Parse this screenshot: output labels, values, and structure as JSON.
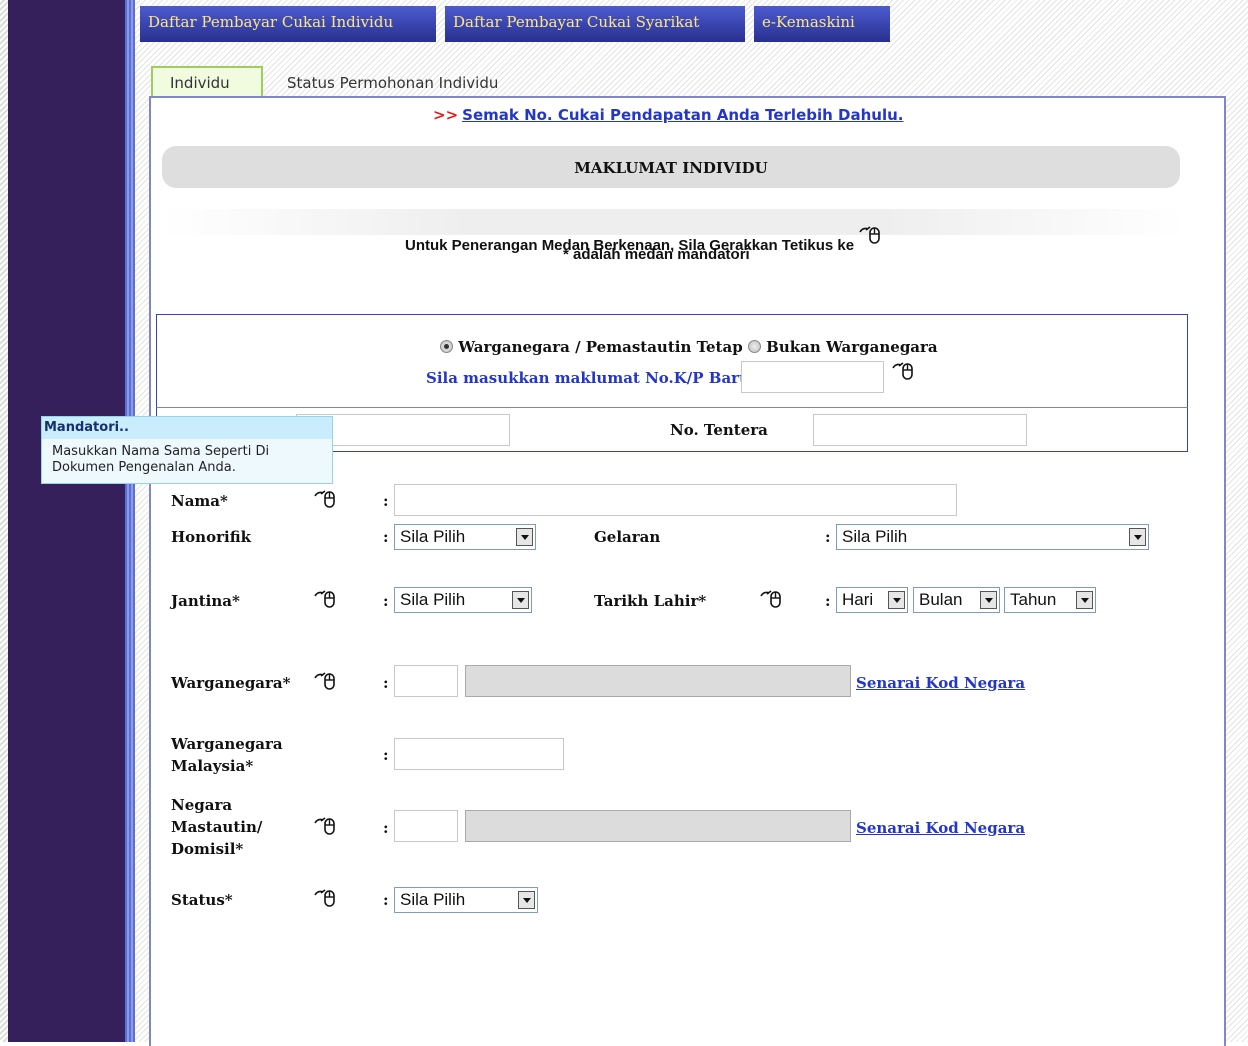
{
  "nav": {
    "tabs": [
      "Daftar Pembayar Cukai Individu",
      "Daftar Pembayar Cukai Syarikat",
      "e-Kemaskini"
    ]
  },
  "subtabs": {
    "active": "Individu",
    "other": "Status Permohonan Individu"
  },
  "check_link": {
    "arrow": ">>",
    "text": "Semak No. Cukai Pendapatan Anda Terlebih Dahulu."
  },
  "section": {
    "title": "MAKLUMAT INDIVIDU",
    "hint": "Untuk Penerangan Medan Berkenaan, Sila Gerakkan Tetikus ke",
    "mandatory_note": "* adalah medan mandatori"
  },
  "identity": {
    "radio_citizen": "Warganegara / Pemastautin Tetap",
    "radio_noncitizen": "Bukan Warganegara",
    "selected": "citizen",
    "kp_label": "Sila masukkan maklumat No.K/P Baru :",
    "kp_value": "",
    "tentera_label": "No. Tentera",
    "tentera_value": ""
  },
  "tooltip": {
    "title": "Mandatori..",
    "line1": "Masukkan Nama Sama Seperti Di",
    "line2": "Dokumen Pengenalan Anda."
  },
  "form": {
    "colon": ":",
    "nama": {
      "label": "Nama*",
      "value": ""
    },
    "honorifik": {
      "label": "Honorifik",
      "value": "Sila Pilih"
    },
    "gelaran": {
      "label": "Gelaran",
      "value": "Sila Pilih"
    },
    "jantina": {
      "label": "Jantina*",
      "value": "Sila Pilih"
    },
    "tarikh_lahir": {
      "label": "Tarikh Lahir*",
      "day": "Hari",
      "month": "Bulan",
      "year": "Tahun"
    },
    "warganegara": {
      "label": "Warganegara*",
      "code": "",
      "name": "",
      "link": "Senarai Kod Negara"
    },
    "warganegara_malaysia": {
      "label_line1": "Warganegara",
      "label_line2": "Malaysia*",
      "value": ""
    },
    "negara_mastautin": {
      "label_line1": "Negara",
      "label_line2": "Mastautin/",
      "label_line3": "Domisil*",
      "code": "",
      "name": "",
      "link": "Senarai Kod Negara"
    },
    "status": {
      "label": "Status*",
      "value": "Sila Pilih"
    }
  }
}
